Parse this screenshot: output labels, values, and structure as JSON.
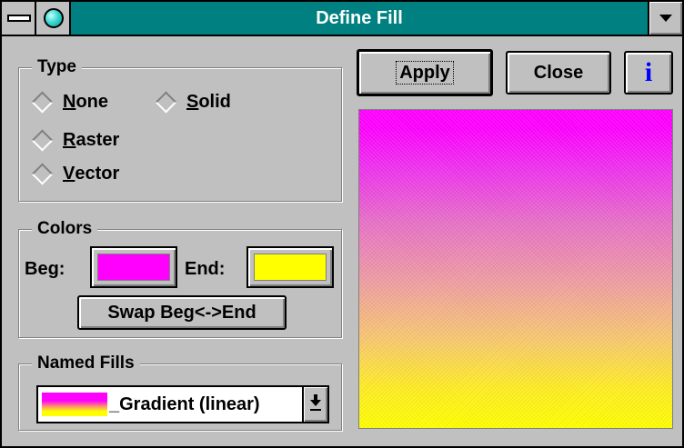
{
  "window": {
    "title": "Define Fill"
  },
  "icons": {
    "system_menu": "system-menu-icon",
    "app": "teal-ball-icon",
    "dropdown": "triangle-down-icon",
    "info": "info-i-icon",
    "combo_arrow": "down-arrow-icon"
  },
  "type_group": {
    "label": "Type",
    "options": [
      {
        "key": "N",
        "rest": "one",
        "selected": false
      },
      {
        "key": "S",
        "rest": "olid",
        "selected": false
      },
      {
        "key": "R",
        "rest": "aster",
        "selected": false
      },
      {
        "key": "V",
        "rest": "ector",
        "selected": false
      }
    ]
  },
  "colors_group": {
    "label": "Colors",
    "beg_label": "Beg:",
    "end_label": "End:",
    "beg_color": "#ff00ff",
    "end_color": "#ffff00",
    "swap_label": "Swap Beg<->End"
  },
  "named_fills": {
    "label": "Named Fills",
    "selected": "_Gradient (linear)"
  },
  "buttons": {
    "apply": "Apply",
    "close": "Close",
    "info": "i"
  }
}
